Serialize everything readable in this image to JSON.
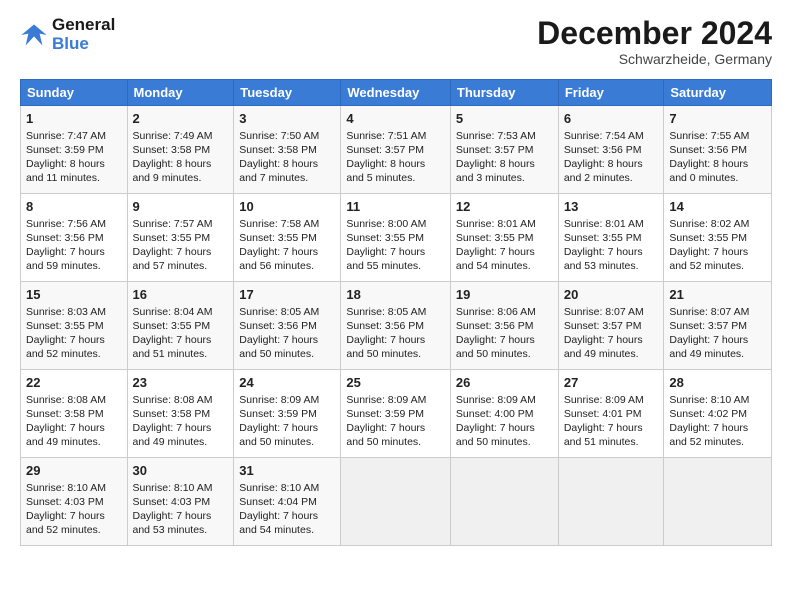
{
  "header": {
    "logo_line1": "General",
    "logo_line2": "Blue",
    "month": "December 2024",
    "location": "Schwarzheide, Germany"
  },
  "weekdays": [
    "Sunday",
    "Monday",
    "Tuesday",
    "Wednesday",
    "Thursday",
    "Friday",
    "Saturday"
  ],
  "weeks": [
    [
      {
        "day": "1",
        "info": "Sunrise: 7:47 AM\nSunset: 3:59 PM\nDaylight: 8 hours\nand 11 minutes."
      },
      {
        "day": "2",
        "info": "Sunrise: 7:49 AM\nSunset: 3:58 PM\nDaylight: 8 hours\nand 9 minutes."
      },
      {
        "day": "3",
        "info": "Sunrise: 7:50 AM\nSunset: 3:58 PM\nDaylight: 8 hours\nand 7 minutes."
      },
      {
        "day": "4",
        "info": "Sunrise: 7:51 AM\nSunset: 3:57 PM\nDaylight: 8 hours\nand 5 minutes."
      },
      {
        "day": "5",
        "info": "Sunrise: 7:53 AM\nSunset: 3:57 PM\nDaylight: 8 hours\nand 3 minutes."
      },
      {
        "day": "6",
        "info": "Sunrise: 7:54 AM\nSunset: 3:56 PM\nDaylight: 8 hours\nand 2 minutes."
      },
      {
        "day": "7",
        "info": "Sunrise: 7:55 AM\nSunset: 3:56 PM\nDaylight: 8 hours\nand 0 minutes."
      }
    ],
    [
      {
        "day": "8",
        "info": "Sunrise: 7:56 AM\nSunset: 3:56 PM\nDaylight: 7 hours\nand 59 minutes."
      },
      {
        "day": "9",
        "info": "Sunrise: 7:57 AM\nSunset: 3:55 PM\nDaylight: 7 hours\nand 57 minutes."
      },
      {
        "day": "10",
        "info": "Sunrise: 7:58 AM\nSunset: 3:55 PM\nDaylight: 7 hours\nand 56 minutes."
      },
      {
        "day": "11",
        "info": "Sunrise: 8:00 AM\nSunset: 3:55 PM\nDaylight: 7 hours\nand 55 minutes."
      },
      {
        "day": "12",
        "info": "Sunrise: 8:01 AM\nSunset: 3:55 PM\nDaylight: 7 hours\nand 54 minutes."
      },
      {
        "day": "13",
        "info": "Sunrise: 8:01 AM\nSunset: 3:55 PM\nDaylight: 7 hours\nand 53 minutes."
      },
      {
        "day": "14",
        "info": "Sunrise: 8:02 AM\nSunset: 3:55 PM\nDaylight: 7 hours\nand 52 minutes."
      }
    ],
    [
      {
        "day": "15",
        "info": "Sunrise: 8:03 AM\nSunset: 3:55 PM\nDaylight: 7 hours\nand 52 minutes."
      },
      {
        "day": "16",
        "info": "Sunrise: 8:04 AM\nSunset: 3:55 PM\nDaylight: 7 hours\nand 51 minutes."
      },
      {
        "day": "17",
        "info": "Sunrise: 8:05 AM\nSunset: 3:56 PM\nDaylight: 7 hours\nand 50 minutes."
      },
      {
        "day": "18",
        "info": "Sunrise: 8:05 AM\nSunset: 3:56 PM\nDaylight: 7 hours\nand 50 minutes."
      },
      {
        "day": "19",
        "info": "Sunrise: 8:06 AM\nSunset: 3:56 PM\nDaylight: 7 hours\nand 50 minutes."
      },
      {
        "day": "20",
        "info": "Sunrise: 8:07 AM\nSunset: 3:57 PM\nDaylight: 7 hours\nand 49 minutes."
      },
      {
        "day": "21",
        "info": "Sunrise: 8:07 AM\nSunset: 3:57 PM\nDaylight: 7 hours\nand 49 minutes."
      }
    ],
    [
      {
        "day": "22",
        "info": "Sunrise: 8:08 AM\nSunset: 3:58 PM\nDaylight: 7 hours\nand 49 minutes."
      },
      {
        "day": "23",
        "info": "Sunrise: 8:08 AM\nSunset: 3:58 PM\nDaylight: 7 hours\nand 49 minutes."
      },
      {
        "day": "24",
        "info": "Sunrise: 8:09 AM\nSunset: 3:59 PM\nDaylight: 7 hours\nand 50 minutes."
      },
      {
        "day": "25",
        "info": "Sunrise: 8:09 AM\nSunset: 3:59 PM\nDaylight: 7 hours\nand 50 minutes."
      },
      {
        "day": "26",
        "info": "Sunrise: 8:09 AM\nSunset: 4:00 PM\nDaylight: 7 hours\nand 50 minutes."
      },
      {
        "day": "27",
        "info": "Sunrise: 8:09 AM\nSunset: 4:01 PM\nDaylight: 7 hours\nand 51 minutes."
      },
      {
        "day": "28",
        "info": "Sunrise: 8:10 AM\nSunset: 4:02 PM\nDaylight: 7 hours\nand 52 minutes."
      }
    ],
    [
      {
        "day": "29",
        "info": "Sunrise: 8:10 AM\nSunset: 4:03 PM\nDaylight: 7 hours\nand 52 minutes."
      },
      {
        "day": "30",
        "info": "Sunrise: 8:10 AM\nSunset: 4:03 PM\nDaylight: 7 hours\nand 53 minutes."
      },
      {
        "day": "31",
        "info": "Sunrise: 8:10 AM\nSunset: 4:04 PM\nDaylight: 7 hours\nand 54 minutes."
      },
      {
        "day": "",
        "info": ""
      },
      {
        "day": "",
        "info": ""
      },
      {
        "day": "",
        "info": ""
      },
      {
        "day": "",
        "info": ""
      }
    ]
  ]
}
